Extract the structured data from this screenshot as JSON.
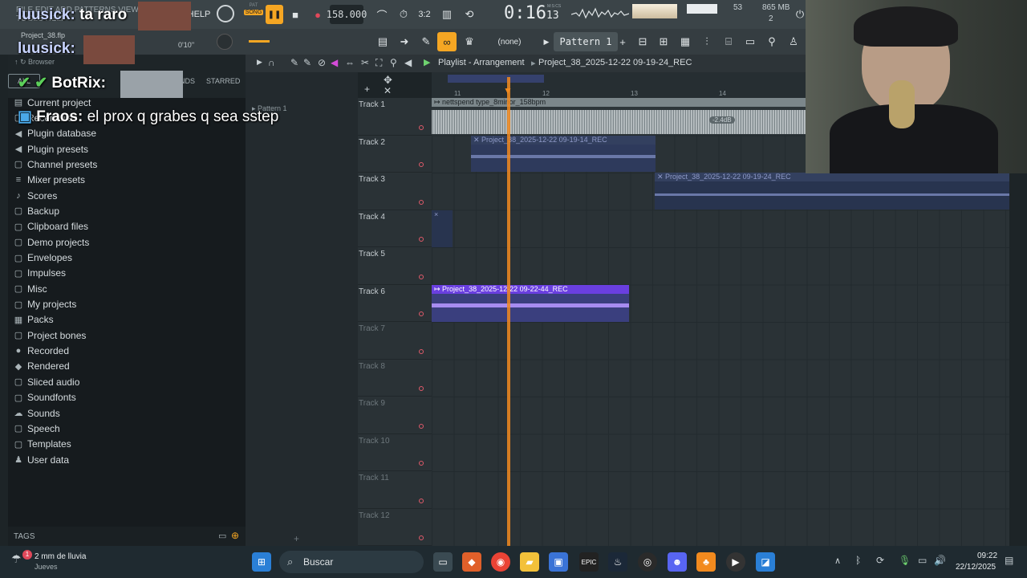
{
  "topbar": {
    "menu_text": "FILE EDIT ADD PATTERNS VIEW OPTIONS TOOLS HELP",
    "help": "HELP",
    "pat_label": "PAT",
    "song_label": "SONG",
    "tempo": "158.000",
    "time_main": "0:16",
    "time_sub": "13",
    "time_caption": "M:S:CS",
    "cpu_value": "53",
    "mem_value": "865 MB",
    "voices": "2",
    "project_file": "Project_38.flp",
    "time_hint": "0'10''",
    "pattern_name": "Pattern 1",
    "channel_none": "(none)"
  },
  "browser": {
    "title": "Browser",
    "tab_all": "ALL",
    "tab_sounds": "NDS",
    "tab_starred": "STARRED",
    "items": [
      {
        "icon": "file-icon",
        "glyph": "▤",
        "label": "Current project"
      },
      {
        "icon": "folder-icon",
        "glyph": "▢",
        "label": "Recent files"
      },
      {
        "icon": "plugin-icon",
        "glyph": "◀",
        "label": "Plugin database"
      },
      {
        "icon": "plugin-icon",
        "glyph": "◀",
        "label": "Plugin presets"
      },
      {
        "icon": "folder-icon",
        "glyph": "▢",
        "label": "Channel presets"
      },
      {
        "icon": "mixer-icon",
        "glyph": "≡",
        "label": "Mixer presets"
      },
      {
        "icon": "note-icon",
        "glyph": "♪",
        "label": "Scores"
      },
      {
        "icon": "folder-icon",
        "glyph": "▢",
        "label": "Backup"
      },
      {
        "icon": "folder-icon",
        "glyph": "▢",
        "label": "Clipboard files"
      },
      {
        "icon": "folder-icon",
        "glyph": "▢",
        "label": "Demo projects"
      },
      {
        "icon": "folder-icon",
        "glyph": "▢",
        "label": "Envelopes"
      },
      {
        "icon": "folder-icon",
        "glyph": "▢",
        "label": "Impulses"
      },
      {
        "icon": "folder-icon",
        "glyph": "▢",
        "label": "Misc"
      },
      {
        "icon": "folder-icon",
        "glyph": "▢",
        "label": "My projects"
      },
      {
        "icon": "packs-icon",
        "glyph": "▦",
        "label": "Packs"
      },
      {
        "icon": "folder-icon",
        "glyph": "▢",
        "label": "Project bones"
      },
      {
        "icon": "mic-icon",
        "glyph": "●",
        "label": "Recorded"
      },
      {
        "icon": "render-icon",
        "glyph": "◆",
        "label": "Rendered"
      },
      {
        "icon": "folder-icon",
        "glyph": "▢",
        "label": "Sliced audio"
      },
      {
        "icon": "folder-icon",
        "glyph": "▢",
        "label": "Soundfonts"
      },
      {
        "icon": "cloud-icon",
        "glyph": "☁",
        "label": "Sounds"
      },
      {
        "icon": "speech-icon",
        "glyph": "▢",
        "label": "Speech"
      },
      {
        "icon": "folder-icon",
        "glyph": "▢",
        "label": "Templates"
      },
      {
        "icon": "user-icon",
        "glyph": "♟",
        "label": "User data"
      }
    ],
    "tags_label": "TAGS"
  },
  "playlist": {
    "title": "Playlist - Arrangement",
    "breadcrumb": "Project_38_2025-12-22 09-19-24_REC",
    "pattern_item": "Pattern 1",
    "ruler_labels": [
      "11",
      "12",
      "13",
      "14"
    ],
    "tracks": [
      "Track 1",
      "Track 2",
      "Track 3",
      "Track 4",
      "Track 5",
      "Track 6",
      "Track 7",
      "Track 8",
      "Track 9",
      "Track 10",
      "Track 11",
      "Track 12"
    ],
    "clips": [
      {
        "name": "nettspend type_8minor_158bpm",
        "gain": "-2.4dB"
      },
      {
        "name": "Project_38_2025-12-22 09-19-14_REC"
      },
      {
        "name": "Project_38_2025-12-22 09-19-24_REC"
      },
      {
        "name": "×"
      },
      {
        "name": "Project_38_2025-12-22 09-22-44_REC"
      }
    ]
  },
  "chat": [
    {
      "user": "luusick:",
      "text": "ta raro"
    },
    {
      "user": "luusick:",
      "text": ""
    },
    {
      "user": "BotRix:",
      "text": ""
    },
    {
      "user": "Fraos:",
      "text": "el prox q grabes q sea sstep"
    }
  ],
  "taskbar": {
    "weather_title": "2 mm de lluvia",
    "weather_sub": "Jueves",
    "weather_badge": "1",
    "search": "Buscar",
    "time": "09:22",
    "date": "22/12/2025"
  },
  "colors": {
    "playhead": "#f28a1e",
    "clip_blue": "#3b4a8a",
    "clip_violet": "#6a3fe0",
    "accent": "#f5a623"
  }
}
